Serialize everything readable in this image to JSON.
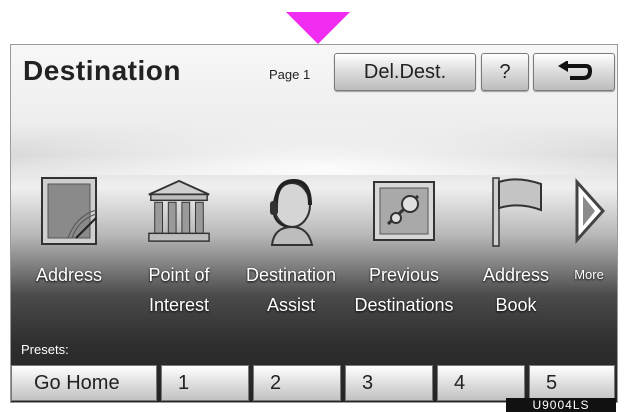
{
  "header": {
    "title": "Destination",
    "page_label": "Page 1",
    "del_dest_label": "Del.Dest.",
    "help_label": "?",
    "back_icon": "back-arrow-icon"
  },
  "menu": {
    "items": [
      {
        "label_line1": "Address",
        "label_line2": "",
        "icon": "address-icon"
      },
      {
        "label_line1": "Point of",
        "label_line2": "Interest",
        "icon": "building-columns-icon"
      },
      {
        "label_line1": "Destination",
        "label_line2": "Assist",
        "icon": "headset-person-icon"
      },
      {
        "label_line1": "Previous",
        "label_line2": "Destinations",
        "icon": "previous-destinations-icon"
      },
      {
        "label_line1": "Address",
        "label_line2": "Book",
        "icon": "flag-icon"
      }
    ],
    "more_label": "More",
    "more_icon": "play-arrow-icon"
  },
  "presets": {
    "label": "Presets:",
    "buttons": [
      "Go Home",
      "1",
      "2",
      "3",
      "4",
      "5"
    ]
  },
  "image_tag": "U9004LS",
  "colors": {
    "pointer": "#f02cf0",
    "label_text": "#ffffff"
  }
}
